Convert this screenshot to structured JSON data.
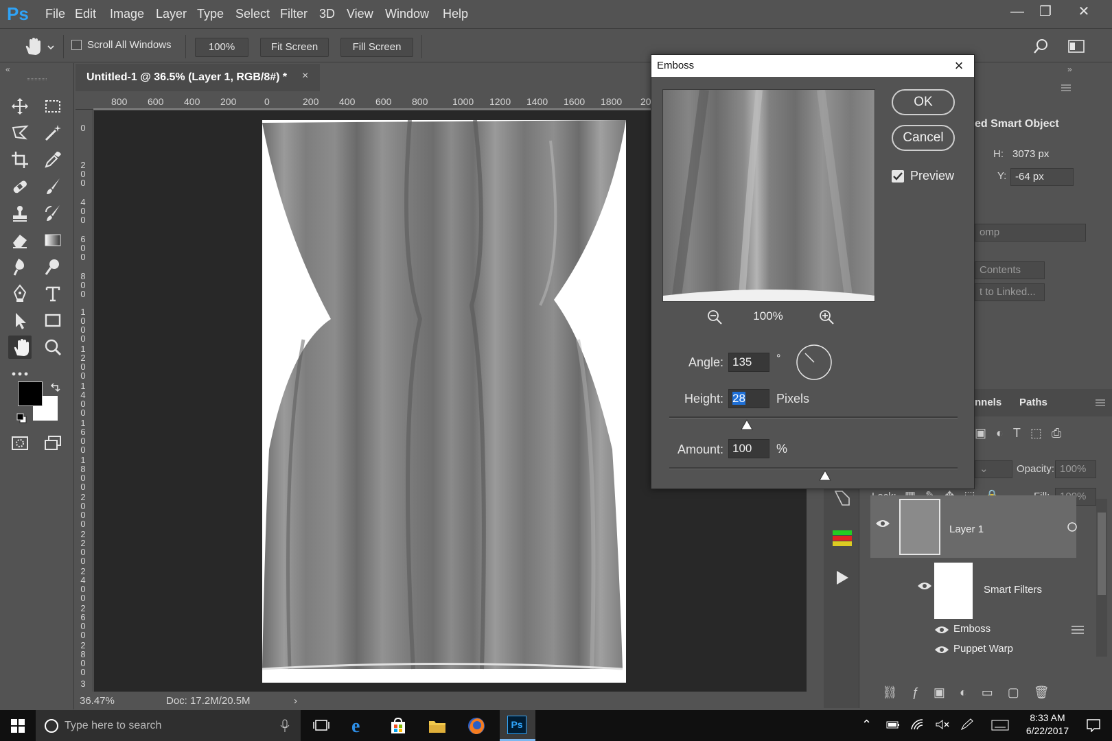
{
  "app": {
    "logo": "Ps"
  },
  "menu": [
    "File",
    "Edit",
    "Image",
    "Layer",
    "Type",
    "Select",
    "Filter",
    "3D",
    "View",
    "Window",
    "Help"
  ],
  "options": {
    "scroll_all_windows": "Scroll All Windows",
    "zoom_button": "100%",
    "fit_screen": "Fit Screen",
    "fill_screen": "Fill Screen"
  },
  "document": {
    "tab_title": "Untitled-1 @ 36.5% (Layer 1, RGB/8#) *",
    "tab_close": "×",
    "zoom": "36.47%",
    "doc_info": "Doc: 17.2M/20.5M",
    "ruler_h": [
      "800",
      "600",
      "400",
      "200",
      "0",
      "200",
      "400",
      "600",
      "800",
      "1000",
      "1200",
      "1400",
      "1600",
      "1800",
      "20"
    ],
    "ruler_v": [
      "0",
      "200",
      "400",
      "600",
      "800",
      "1000",
      "1200",
      "1400",
      "1600",
      "1800",
      "2000",
      "2200",
      "2400",
      "2600",
      "2800",
      "3"
    ]
  },
  "properties": {
    "title": "ed Smart Object",
    "h_label": "H:",
    "h_value": "3073 px",
    "y_label": "Y:",
    "y_value": "-64 px",
    "comp_select": "omp",
    "edit_contents": "Contents",
    "convert_linked": "t to Linked..."
  },
  "layers_panel": {
    "tab_channels": "nnels",
    "tab_paths": "Paths",
    "opacity_label": "Opacity:",
    "opacity_value": "100%",
    "lock_label": "Lock:",
    "fill_label": "Fill:",
    "fill_value": "100%",
    "layer_name": "Layer 1",
    "smart_filters": "Smart Filters",
    "filters": [
      "Emboss",
      "Puppet Warp"
    ]
  },
  "emboss_dialog": {
    "title": "Emboss",
    "ok": "OK",
    "cancel": "Cancel",
    "preview_label": "Preview",
    "preview_checked": true,
    "preview_zoom": "100%",
    "angle_label": "Angle:",
    "angle_value": "135",
    "angle_unit": "°",
    "height_label": "Height:",
    "height_value": "28",
    "height_unit": "Pixels",
    "height_slider": 0.27,
    "amount_label": "Amount:",
    "amount_value": "100",
    "amount_unit": "%",
    "amount_slider": 0.54
  },
  "taskbar": {
    "search_placeholder": "Type here to search",
    "time": "8:33 AM",
    "date": "6/22/2017"
  },
  "colors": {
    "accent": "#2fa3f7",
    "panel": "#535353",
    "canvas_bg": "#282828"
  }
}
